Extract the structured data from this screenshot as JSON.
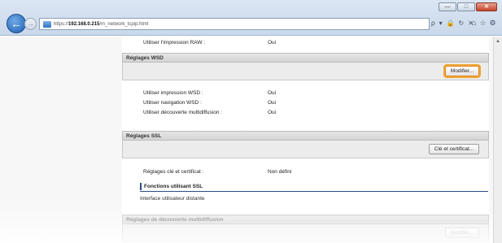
{
  "window": {
    "minimize_glyph": "—",
    "maximize_glyph": "□",
    "close_glyph": "✕"
  },
  "browser": {
    "url_prefix": "https://",
    "url_host": "192.168.0.215",
    "url_path": "/m_network_tcpip.html",
    "back_glyph": "←",
    "forward_glyph": "→",
    "search_glyph": "ρ",
    "dropdown_glyph": "▾",
    "cert_glyph": "🔒",
    "refresh_glyph": "↻",
    "stop_glyph": "✕",
    "home_glyph": "⌂",
    "favorites_glyph": "☆",
    "tools_glyph": "⚙"
  },
  "raw": {
    "label": "Utiliser l'impression RAW :",
    "value": "Oui"
  },
  "wsd": {
    "title": "Réglages WSD",
    "edit_button": "Modifier...",
    "rows": [
      {
        "label": "Utiliser impression WSD :",
        "value": "Oui"
      },
      {
        "label": "Utiliser navigation WSD :",
        "value": "Oui"
      },
      {
        "label": "Utiliser découverte multidiffusion :",
        "value": "Oui"
      }
    ]
  },
  "ssl": {
    "title": "Réglages SSL",
    "key_button": "Clé et certificat...",
    "row": {
      "label": "Réglages clé et certificat :",
      "value": "Non défini"
    },
    "sub_title": "Fonctions utilisant SSL",
    "sub_item": "Interface utilisateur distante"
  },
  "multicast": {
    "title": "Réglages de découverte multidiffusion",
    "edit_button": "Modifier..."
  },
  "colors": {
    "focus_ring": "#f0a436",
    "section_header": "#d9d9d9",
    "sub_title_rule": "#2a4e85"
  }
}
